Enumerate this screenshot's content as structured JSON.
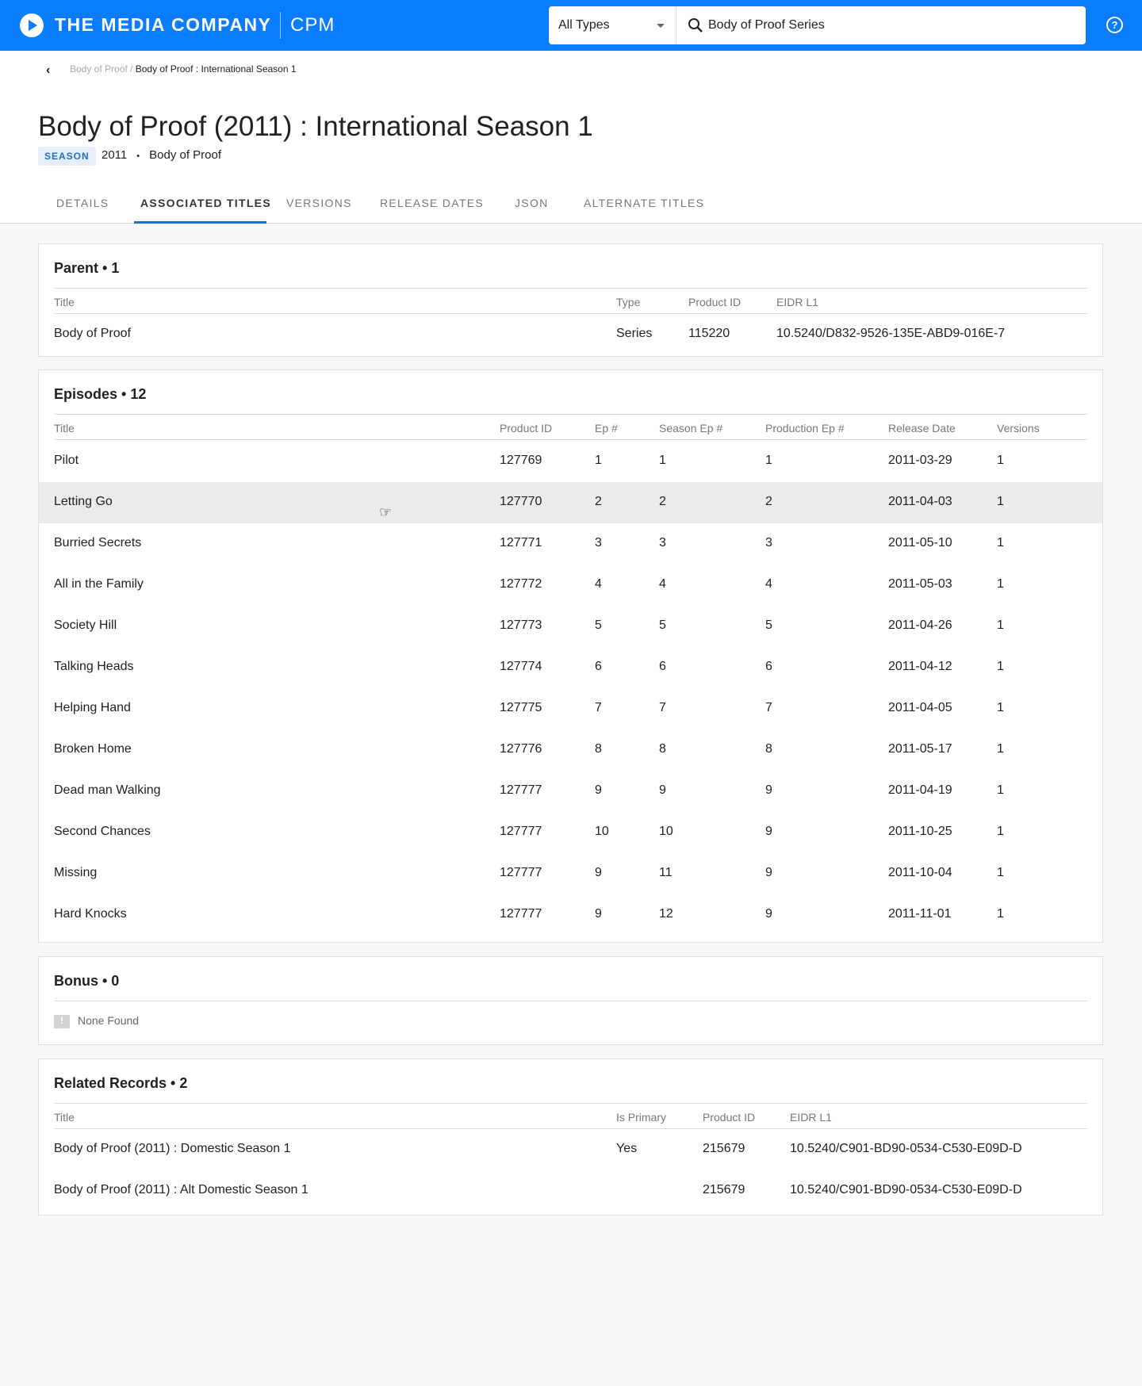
{
  "header": {
    "brand": "THE MEDIA COMPANY",
    "app": "CPM",
    "type_select": "All Types",
    "search_value": "Body of Proof Series",
    "help": "?"
  },
  "breadcrumb": {
    "parent": "Body of Proof",
    "sep": " / ",
    "current": "Body of Proof : International Season 1"
  },
  "title": "Body of Proof (2011) : International Season 1",
  "badge": "SEASON",
  "year": "2011",
  "dot": "•",
  "series": "Body of Proof",
  "tabs": [
    "DETAILS",
    "ASSOCIATED TITLES",
    "VERSIONS",
    "RELEASE DATES",
    "JSON",
    "ALTERNATE TITLES"
  ],
  "parent": {
    "heading": "Parent • 1",
    "columns": [
      "Title",
      "Type",
      "Product ID",
      "EIDR L1"
    ],
    "rows": [
      [
        "Body of Proof",
        "Series",
        "115220",
        "10.5240/D832-9526-135E-ABD9-016E-7"
      ]
    ]
  },
  "episodes": {
    "heading": "Episodes • 12",
    "columns": [
      "Title",
      "Product ID",
      "Ep #",
      "Season Ep #",
      "Production Ep #",
      "Release Date",
      "Versions"
    ],
    "rows": [
      [
        "Pilot",
        "127769",
        "1",
        "1",
        "1",
        "2011-03-29",
        "1"
      ],
      [
        "Letting Go",
        "127770",
        "2",
        "2",
        "2",
        "2011-04-03",
        "1"
      ],
      [
        "Burried Secrets",
        "127771",
        "3",
        "3",
        "3",
        "2011-05-10",
        "1"
      ],
      [
        "All in the Family",
        "127772",
        "4",
        "4",
        "4",
        "2011-05-03",
        "1"
      ],
      [
        "Society Hill",
        "127773",
        "5",
        "5",
        "5",
        "2011-04-26",
        "1"
      ],
      [
        "Talking Heads",
        "127774",
        "6",
        "6",
        "6",
        "2011-04-12",
        "1"
      ],
      [
        "Helping Hand",
        "127775",
        "7",
        "7",
        "7",
        "2011-04-05",
        "1"
      ],
      [
        "Broken Home",
        "127776",
        "8",
        "8",
        "8",
        "2011-05-17",
        "1"
      ],
      [
        "Dead man Walking",
        "127777",
        "9",
        "9",
        "9",
        "2011-04-19",
        "1"
      ],
      [
        "Second Chances",
        "127777",
        "10",
        "10",
        "9",
        "2011-10-25",
        "1"
      ],
      [
        "Missing",
        "127777",
        "9",
        "11",
        "9",
        "2011-10-04",
        "1"
      ],
      [
        "Hard Knocks",
        "127777",
        "9",
        "12",
        "9",
        "2011-11-01",
        "1"
      ]
    ]
  },
  "bonus": {
    "heading": "Bonus • 0",
    "empty": "None Found"
  },
  "related": {
    "heading": "Related Records • 2",
    "columns": [
      "Title",
      "Is Primary",
      "Product ID",
      "EIDR L1"
    ],
    "rows": [
      [
        "Body of Proof (2011) : Domestic Season 1",
        "Yes",
        "215679",
        "10.5240/C901-BD90-0534-C530-E09D-D"
      ],
      [
        "Body of Proof (2011) : Alt Domestic Season 1",
        "",
        "215679",
        "10.5240/C901-BD90-0534-C530-E09D-D"
      ]
    ]
  }
}
